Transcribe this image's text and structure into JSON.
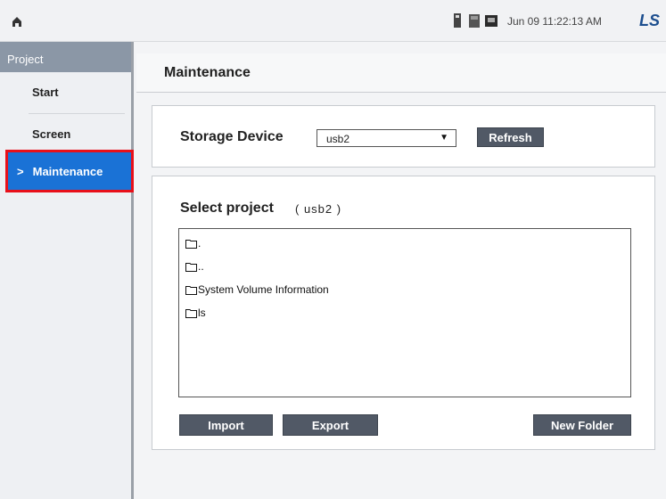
{
  "topbar": {
    "home_icon": "home-icon",
    "status_icons": [
      "sd-card-icon",
      "memory-card-icon",
      "device-icon"
    ],
    "datetime": "Jun 09 11:22:13 AM",
    "brand": "LS"
  },
  "sidebar": {
    "header": "Project",
    "items": [
      {
        "label": "Start"
      },
      {
        "label": "Screen"
      },
      {
        "label": "Maintenance",
        "marker": ">"
      }
    ],
    "active_highlight": "#1a72d6",
    "outline_color": "#e8101a"
  },
  "main": {
    "title": "Maintenance",
    "storage": {
      "label": "Storage Device",
      "selected": "usb2",
      "arrow": "▼",
      "refresh_label": "Refresh"
    },
    "project": {
      "label": "Select project",
      "device_display": "( usb2 )",
      "files": [
        ".",
        "..",
        "System Volume Information",
        "ls"
      ]
    },
    "buttons": {
      "import": "Import",
      "export": "Export",
      "new_folder": "New Folder"
    }
  }
}
